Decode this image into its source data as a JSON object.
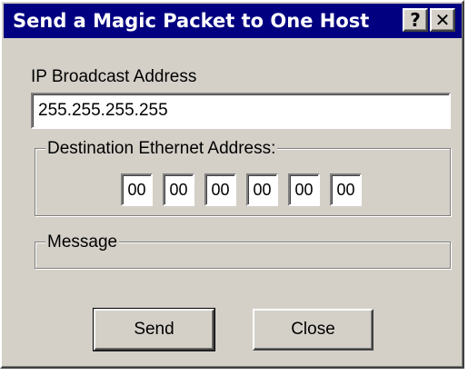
{
  "window": {
    "title": "Send a Magic Packet to One Host",
    "help_glyph": "?",
    "close_glyph": "✕"
  },
  "ip_broadcast": {
    "label": "IP Broadcast Address",
    "value": "255.255.255.255"
  },
  "destination": {
    "legend": "Destination Ethernet Address:",
    "octets": [
      "00",
      "00",
      "00",
      "00",
      "00",
      "00"
    ]
  },
  "message": {
    "legend": "Message",
    "text": ""
  },
  "buttons": {
    "send_label": "Send",
    "close_label": "Close"
  },
  "colors": {
    "titlebar": "#000080",
    "face": "#d4d0c8"
  }
}
